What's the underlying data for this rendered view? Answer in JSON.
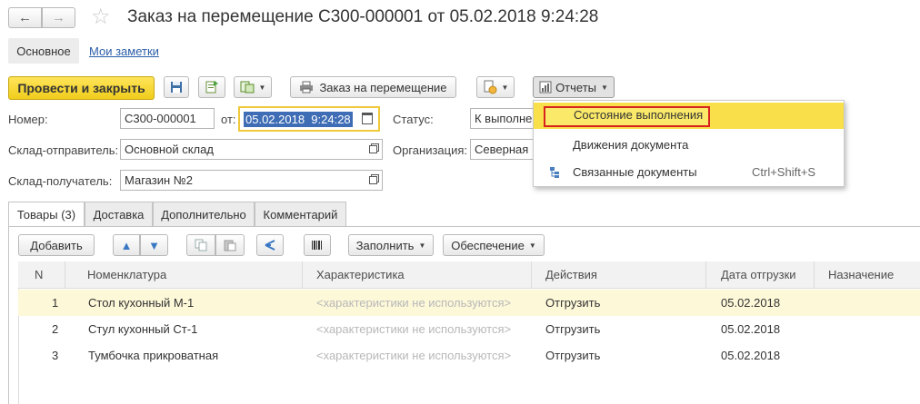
{
  "header": {
    "title": "Заказ на перемещение С300-000001 от 05.02.2018 9:24:28"
  },
  "nav_tabs": {
    "main": "Основное",
    "notes": "Мои заметки"
  },
  "toolbar": {
    "post_close": "Провести и закрыть",
    "print_doc": "Заказ на перемещение",
    "reports": "Отчеты"
  },
  "form": {
    "number_label": "Номер:",
    "number_value": "С300-000001",
    "date_label": "от:",
    "date_value": "05.02.2018  9:24:28",
    "status_label": "Статус:",
    "status_value": "К выполне",
    "sender_label": "Склад-отправитель:",
    "sender_value": "Основной склад",
    "org_label": "Организация:",
    "org_value": "Северная",
    "receiver_label": "Склад-получатель:",
    "receiver_value": "Магазин №2"
  },
  "reports_menu": {
    "items": [
      {
        "label": "Состояние выполнения",
        "shortcut": ""
      },
      {
        "label": "Движения документа",
        "shortcut": ""
      },
      {
        "label": "Связанные документы",
        "shortcut": "Ctrl+Shift+S"
      }
    ]
  },
  "doc_tabs": [
    "Товары (3)",
    "Доставка",
    "Дополнительно",
    "Комментарий"
  ],
  "table_toolbar": {
    "add": "Добавить",
    "fill": "Заполнить",
    "provision": "Обеспечение"
  },
  "table": {
    "columns": [
      "N",
      "Номенклатура",
      "Характеристика",
      "Действия",
      "Дата отгрузки",
      "Назначение"
    ],
    "rows": [
      {
        "n": "1",
        "item": "Стол кухонный М-1",
        "char": "<характеристики не используются>",
        "action": "Отгрузить",
        "date": "05.02.2018",
        "purpose": ""
      },
      {
        "n": "2",
        "item": "Стул кухонный Ст-1",
        "char": "<характеристики не используются>",
        "action": "Отгрузить",
        "date": "05.02.2018",
        "purpose": ""
      },
      {
        "n": "3",
        "item": "Тумбочка прикроватная",
        "char": "<характеристики не используются>",
        "action": "Отгрузить",
        "date": "05.02.2018",
        "purpose": ""
      }
    ]
  },
  "colors": {
    "primary_button": "#f5d423",
    "menu_highlight": "#f9e04a",
    "highlight_border": "#d8231e",
    "selected_row": "#fcf8d8",
    "date_field_border": "#f0c93a"
  }
}
